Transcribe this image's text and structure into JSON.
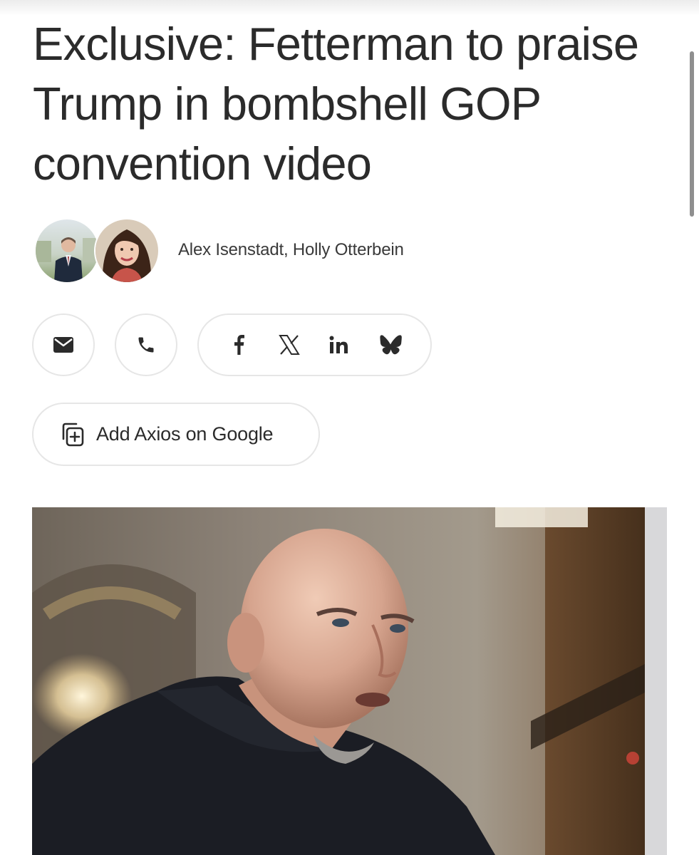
{
  "article": {
    "headline": "Exclusive: Fetterman to praise Trump in bombshell GOP convention video",
    "authors": "Alex Isenstadt, Holly Otterbein"
  },
  "share": {
    "email_icon": "email-icon",
    "phone_icon": "phone-icon",
    "facebook_icon": "facebook-icon",
    "x_icon": "x-icon",
    "linkedin_icon": "linkedin-icon",
    "bluesky_icon": "bluesky-icon",
    "facebook_glyph": "f",
    "x_glyph": "𝕏",
    "linkedin_glyph": "in"
  },
  "google_button": {
    "label": "Add Axios on Google",
    "icon": "add-to-stack-icon"
  },
  "colors": {
    "text": "#2b2b2b",
    "border": "#e6e6e6",
    "background": "#ffffff"
  }
}
